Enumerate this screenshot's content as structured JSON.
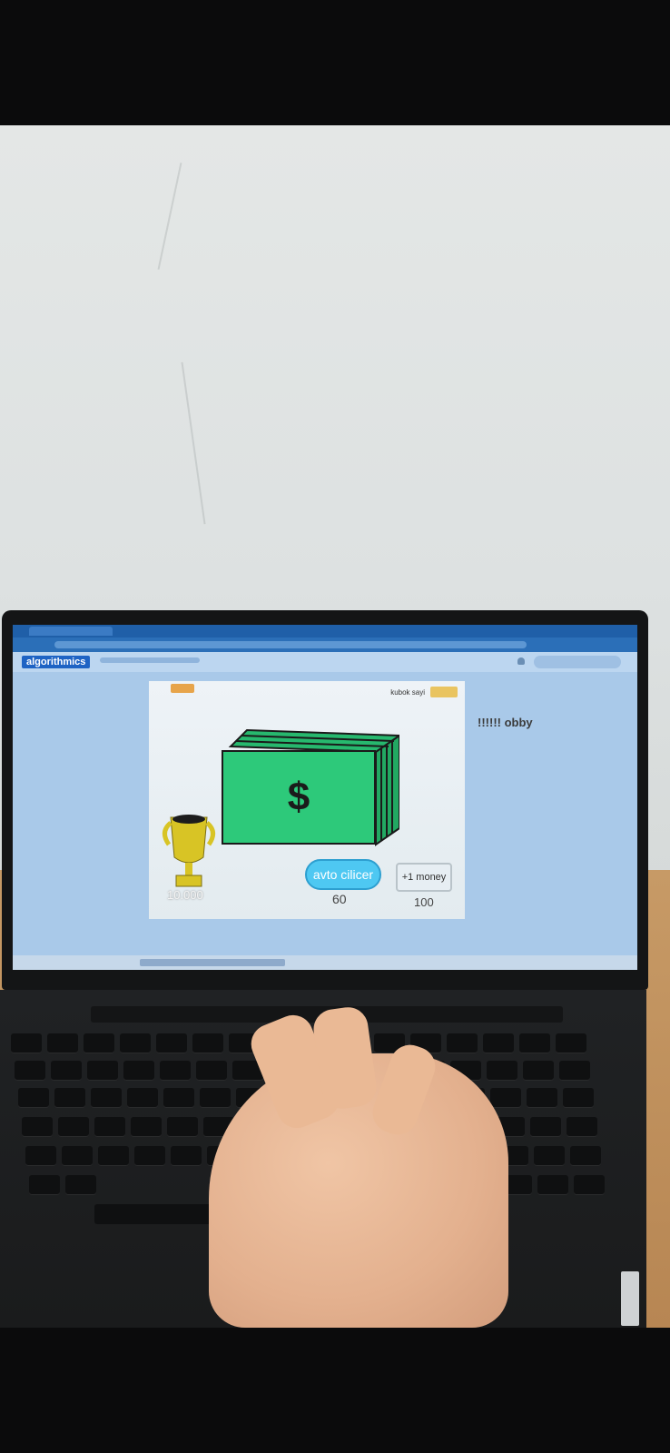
{
  "game": {
    "kubok_label": "kubok sayi",
    "score": "10.000",
    "auto_clicker_label": "avto cilicer",
    "auto_clicker_cost": "60",
    "money_button_label": "+1 money",
    "money_button_cost": "100",
    "dollar_symbol": "$"
  },
  "browser": {
    "logo": "algorithmics"
  },
  "side_text": "!!!!!! obby",
  "colors": {
    "cash": "#2dc97a",
    "auto_button": "#4ec8f2",
    "trophy": "#d8c425"
  }
}
